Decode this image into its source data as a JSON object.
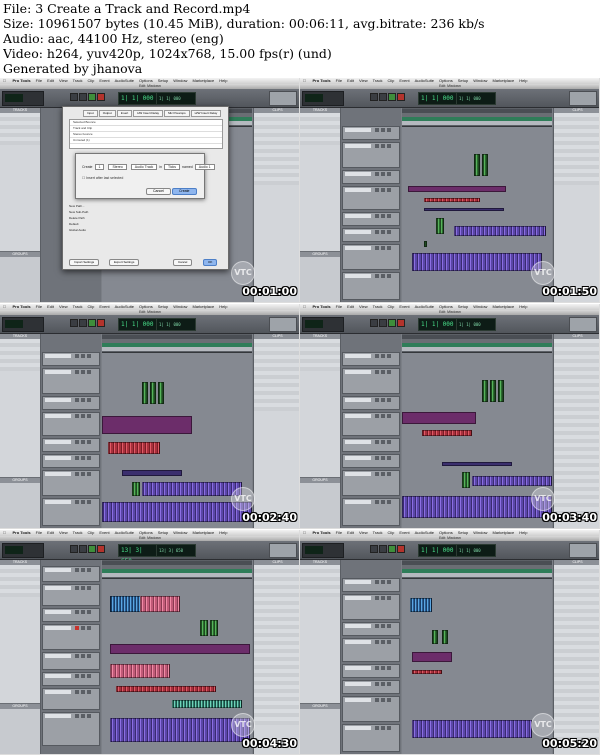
{
  "header": {
    "line1": "File: 3 Create a Track and Record.mp4",
    "line2": "Size: 10961507 bytes (10.45 MiB), duration: 00:06:11, avg.bitrate: 236 kb/s",
    "line3": "Audio: aac, 44100 Hz, stereo (eng)",
    "line4": "Video: h264, yuv420p, 1024x768, 15.00 fps(r) (und)",
    "line5": "Generated by jhanova"
  },
  "app": {
    "menu": [
      "Pro Tools",
      "File",
      "Edit",
      "View",
      "Track",
      "Clip",
      "Event",
      "AudioSuite",
      "Options",
      "Setup",
      "Window",
      "Marketplace",
      "Help"
    ],
    "window_title": "Edit: Mixdown",
    "tracks_panel": "TRACKS",
    "groups_panel": "GROUPS",
    "clips_panel": "CLIPS",
    "watermark": "VTC"
  },
  "thumbnails": [
    {
      "timestamp": "00:01:00",
      "counter": "1| 1| 000"
    },
    {
      "timestamp": "00:01:50",
      "counter": "1| 1| 000"
    },
    {
      "timestamp": "00:02:40",
      "counter": "1| 1| 000"
    },
    {
      "timestamp": "00:03:40",
      "counter": "1| 1| 000"
    },
    {
      "timestamp": "00:04:30",
      "counter": "13| 3| 650"
    },
    {
      "timestamp": "00:05:20",
      "counter": "1| 1| 000"
    }
  ],
  "dialog": {
    "tabs": [
      "Input",
      "Output",
      "Insert",
      "HW Insert Delay",
      "Mic Preamps",
      "H/W Insert Delay"
    ],
    "rows": [
      "Selected Bounce",
      "Track and Clip",
      "Stereo bounce",
      "Unmuted (1)"
    ],
    "sub": {
      "create_label": "Create",
      "count": "1",
      "type": "Stereo",
      "format": "Audio Track",
      "in_label": "in",
      "samples": "Ticks",
      "named_label": "named",
      "name_value": "Audio 1",
      "checkbox": "Insert after last selected",
      "cancel": "Cancel",
      "create": "Create"
    },
    "labels": [
      "New Path...",
      "New Sub-Path",
      "Delete Path",
      "Default",
      "Global Audio"
    ],
    "cancel": "Cancel",
    "ok": "OK",
    "import": "Import Settings",
    "export": "Export Settings"
  }
}
